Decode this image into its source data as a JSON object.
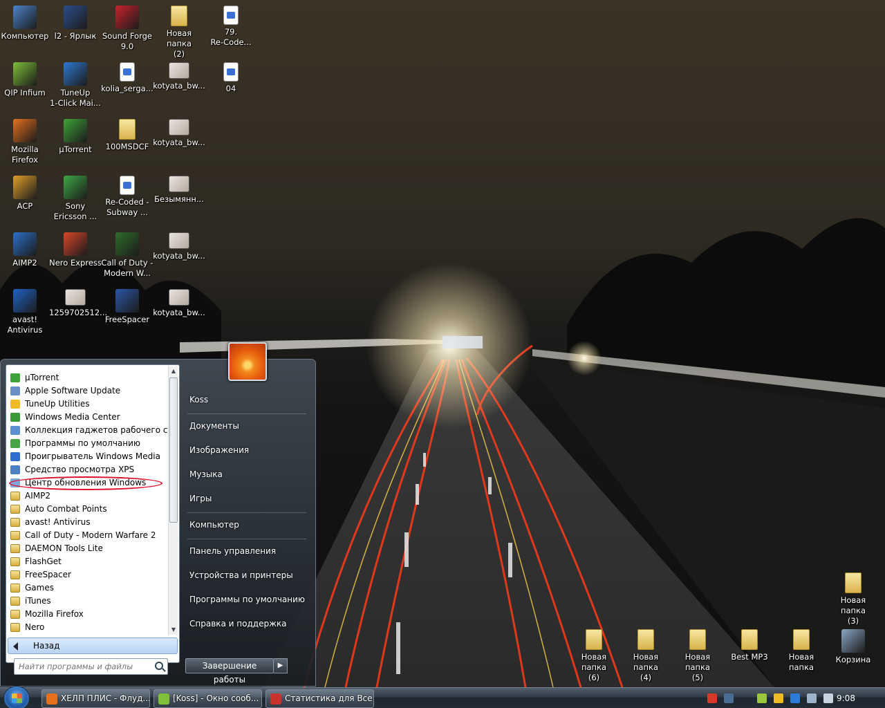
{
  "desktop": {
    "icons": [
      {
        "label": "Компьютер",
        "color": "#4a84c9"
      },
      {
        "label": "l2 - Ярлык",
        "color": "#2b4e8c"
      },
      {
        "label": "Sound Forge\n9.0",
        "color": "#c9222d"
      },
      {
        "label": "Новая папка\n(2)",
        "color": "#d9b34c"
      },
      {
        "label": "79.\nRe-Code...",
        "color": "#3a6fd6"
      },
      {
        "label": "QIP Infium",
        "color": "#7fbf3a"
      },
      {
        "label": "TuneUp\n1-Click Mai...",
        "color": "#2f78d1"
      },
      {
        "label": "kolia_serga...",
        "color": "#3a6fd6"
      },
      {
        "label": "kotyata_bw...",
        "color": "#6b635a"
      },
      {
        "label": "04",
        "color": "#3a6fd6"
      },
      {
        "label": "Mozilla\nFirefox",
        "color": "#e4701e"
      },
      {
        "label": "µTorrent",
        "color": "#3ea33a"
      },
      {
        "label": "100MSDCF",
        "color": "#d9b34c"
      },
      {
        "label": "kotyata_bw...",
        "color": "#c8bdb3"
      },
      {
        "label": "ACP",
        "color": "#e0a02a"
      },
      {
        "label": "Sony\nEricsson ...",
        "color": "#3fa845"
      },
      {
        "label": "Re-Coded -\nSubway ...",
        "color": "#3a6fd6"
      },
      {
        "label": "Безымянн...",
        "color": "#dcdcdc"
      },
      {
        "label": "AIMP2",
        "color": "#2d6fc8"
      },
      {
        "label": "Nero Express",
        "color": "#d8452a"
      },
      {
        "label": "Call of Duty -\nModern W...",
        "color": "#2f6d2a"
      },
      {
        "label": "kotyata_bw...",
        "color": "#cfc6bd"
      },
      {
        "label": "avast!\nAntivirus",
        "color": "#1f63c6"
      },
      {
        "label": "1259702512...",
        "color": "#c99a7a"
      },
      {
        "label": "FreeSpacer",
        "color": "#2a56a6"
      },
      {
        "label": "kotyata_bw...",
        "color": "#7a6e66"
      },
      {
        "label": "Новая папка\n(3)",
        "color": "#d9b34c"
      },
      {
        "label": "Новая папка\n(6)",
        "color": "#d9b34c"
      },
      {
        "label": "Новая папка\n(4)",
        "color": "#d9b34c"
      },
      {
        "label": "Новая папка\n(5)",
        "color": "#d9b34c"
      },
      {
        "label": "Best MP3",
        "color": "#d9b34c"
      },
      {
        "label": "Новая папка",
        "color": "#d9b34c"
      },
      {
        "label": "Корзина",
        "color": "#8aa6c2"
      }
    ]
  },
  "start_menu": {
    "programs": [
      {
        "label": "µTorrent",
        "icon": "utorrent-icon",
        "color": "#3ea33a"
      },
      {
        "label": "Apple Software Update",
        "icon": "apple-update-icon",
        "color": "#6a8fc8"
      },
      {
        "label": "TuneUp Utilities",
        "icon": "tuneup-icon",
        "color": "#f0b928"
      },
      {
        "label": "Windows Media Center",
        "icon": "media-center-icon",
        "color": "#3a9a3a"
      },
      {
        "label": "Коллекция гаджетов рабочего стола",
        "icon": "gadgets-icon",
        "color": "#5b8fd0"
      },
      {
        "label": "Программы по умолчанию",
        "icon": "default-programs-icon",
        "color": "#46a447"
      },
      {
        "label": "Проигрыватель Windows Media",
        "icon": "media-player-icon",
        "color": "#2f6dcf"
      },
      {
        "label": "Средство просмотра XPS",
        "icon": "xps-icon",
        "color": "#4d7fc4"
      },
      {
        "label": "Центр обновления Windows",
        "icon": "windows-update-icon",
        "color": "#7fa7d8"
      },
      {
        "label": "AIMP2",
        "icon": "folder-icon",
        "color": ""
      },
      {
        "label": "Auto Combat Points",
        "icon": "folder-icon",
        "color": ""
      },
      {
        "label": "avast! Antivirus",
        "icon": "folder-icon",
        "color": ""
      },
      {
        "label": "Call of Duty - Modern Warfare 2",
        "icon": "folder-icon",
        "color": ""
      },
      {
        "label": "DAEMON Tools Lite",
        "icon": "folder-icon",
        "color": ""
      },
      {
        "label": "FlashGet",
        "icon": "folder-icon",
        "color": ""
      },
      {
        "label": "FreeSpacer",
        "icon": "folder-icon",
        "color": ""
      },
      {
        "label": "Games",
        "icon": "folder-icon",
        "color": ""
      },
      {
        "label": "iTunes",
        "icon": "folder-icon",
        "color": ""
      },
      {
        "label": "Mozilla Firefox",
        "icon": "folder-icon",
        "color": ""
      },
      {
        "label": "Nero",
        "icon": "folder-icon",
        "color": ""
      }
    ],
    "back_label": "Назад",
    "search_placeholder": "Найти программы и файлы",
    "right_links": [
      {
        "label": "Koss",
        "name": "user-name-link"
      },
      {
        "label": "Документы",
        "name": "documents-link"
      },
      {
        "label": "Изображения",
        "name": "pictures-link"
      },
      {
        "label": "Музыка",
        "name": "music-link"
      },
      {
        "label": "Игры",
        "name": "games-link"
      },
      {
        "label": "Компьютер",
        "name": "computer-link"
      },
      {
        "label": "Панель управления",
        "name": "control-panel-link"
      },
      {
        "label": "Устройства и принтеры",
        "name": "devices-printers-link"
      },
      {
        "label": "Программы по умолчанию",
        "name": "default-programs-link"
      },
      {
        "label": "Справка и поддержка",
        "name": "help-support-link"
      }
    ],
    "shutdown_label": "Завершение работы"
  },
  "taskbar": {
    "buttons": [
      {
        "label": "ХЕЛП ПЛИС - Флуд...",
        "icon": "firefox-icon",
        "color": "#e4701e"
      },
      {
        "label": "[Koss] - Окно сооб...",
        "icon": "qip-message-icon",
        "color": "#7fbf3a"
      },
      {
        "label": "Статистика для Все ...",
        "icon": "stats-app-icon",
        "color": "#c8332e"
      }
    ],
    "tray_icons": [
      {
        "name": "tray-app-icon",
        "color": "#d33a2a"
      },
      {
        "name": "language-icon",
        "color": "#4a6d94"
      },
      {
        "name": "qip-tray-icon",
        "color": "#9bc53d"
      },
      {
        "name": "tuneup-tray-icon",
        "color": "#f0b928"
      },
      {
        "name": "avast-tray-icon",
        "color": "#2d7bd6"
      },
      {
        "name": "network-icon",
        "color": "#9fb4c9"
      },
      {
        "name": "volume-icon",
        "color": "#c7d3df"
      }
    ],
    "clock": "9:08"
  }
}
